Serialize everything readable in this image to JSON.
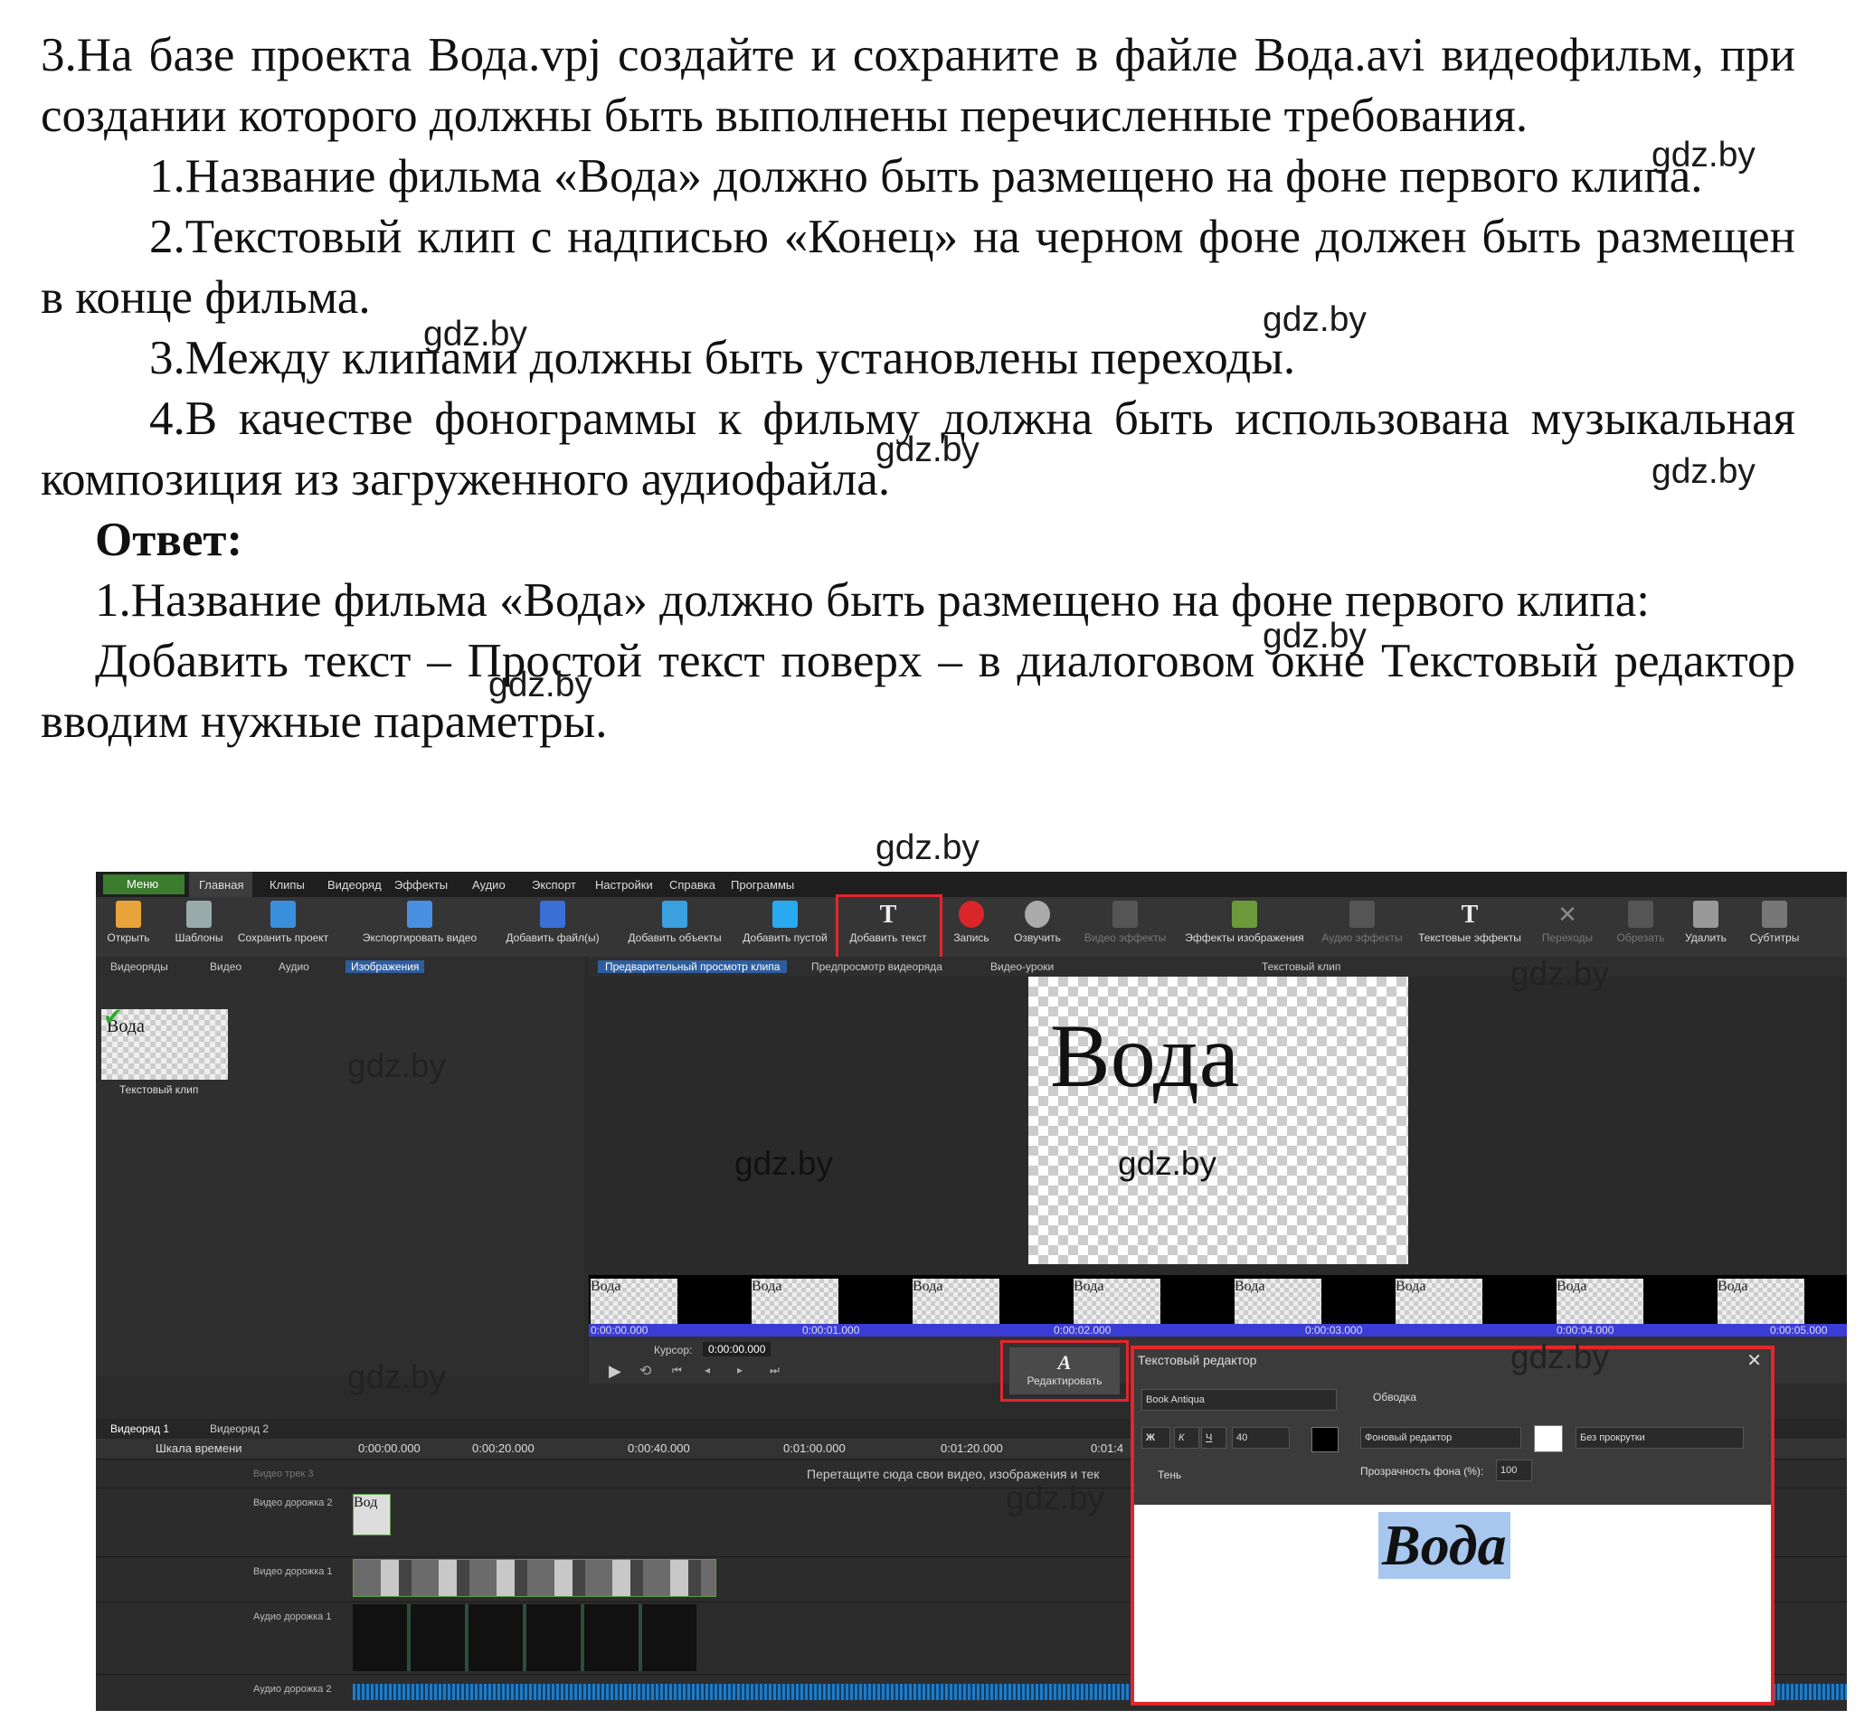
{
  "task": {
    "intro": "3.На базе проекта Вода.vpj создайте и сохраните в файле Вода.avi видеофильм, при создании которого должны быть выполнены перечисленные требования.",
    "req1": "1.Название фильма «Вода» должно быть размещено на фоне первого клипа.",
    "req2": "2.Текстовый клип с надписью «Конец» на черном фоне должен быть размещен в конце фильма.",
    "req3": "3.Между клипами должны быть установлены переходы.",
    "req4": "4.В качестве фонограммы к фильму должна быть использована музыкальная композиция из загруженного аудиофайла."
  },
  "answer": {
    "heading": "Ответ:",
    "line1": "1.Название фильма «Вода» должно быть размещено на фоне первого клипа:",
    "line2": "Добавить текст – Простой текст поверх – в диалоговом окне Текстовый редактор вводим нужные параметры."
  },
  "watermark": "gdz.by",
  "screenshot": {
    "menu": [
      "Меню",
      "Главная",
      "Клипы",
      "Видеоряд",
      "Эффекты",
      "Аудио",
      "Экспорт",
      "Настройки",
      "Справка",
      "Программы"
    ],
    "toolbar": [
      "Открыть",
      "Шаблоны",
      "Сохранить проект",
      "Экспортировать видео",
      "Добавить файл(ы)",
      "Добавить объекты",
      "Добавить пустой",
      "Добавить текст",
      "Запись",
      "Озвучить",
      "Видео эффекты",
      "Эффекты изображения",
      "Аудио эффекты",
      "Текстовые эффекты",
      "Переходы",
      "Обрезать",
      "Удалить",
      "Субтитры"
    ],
    "left_tabs": [
      "Видеоряды",
      "Видео",
      "Аудио",
      "Изображения"
    ],
    "preview_tabs": [
      "Предварительный просмотр клипа",
      "Предпросмотр видеоряда",
      "Видео-уроки"
    ],
    "preview_title": "Текстовый клип",
    "clip_thumb_text": "Вода",
    "clip_thumb_label": "Текстовый клип",
    "canvas_text": "Вода",
    "strip_label": "Вода",
    "ruler": [
      "0:00:00.000",
      "0:00:01.000",
      "0:00:02.000",
      "0:00:03.000",
      "0:00:04.000",
      "0:00:05.000"
    ],
    "cursor_label": "Курсор:",
    "cursor_value": "0:00:00.000",
    "edit_button": "Редактировать",
    "timeline_tabs": [
      "Видеоряд 1",
      "Видеоряд 2"
    ],
    "timeline_scale": "Шкала времени",
    "timeline_ruler": [
      "0:00:00.000",
      "0:00:20.000",
      "0:00:40.000",
      "0:01:00.000",
      "0:01:20.000",
      "0:01:4"
    ],
    "tracks": [
      "Видео трек 3",
      "Видео дорожка 2",
      "Видео дорожка 1",
      "Аудио дорожка 1",
      "Аудио дорожка 2"
    ],
    "drop_hint": "Перетащите сюда свои видео, изображения и тек",
    "text_clip_label": "Вод",
    "editor": {
      "title": "Текстовый редактор",
      "font": "Book Antiqua",
      "bold": "Ж",
      "italic": "К",
      "underline": "Ч",
      "size": "40",
      "shadow": "Тень",
      "outline": "Обводка",
      "bg_mode": "Фоновый редактор",
      "bg_opacity_label": "Прозрачность фона (%):",
      "bg_opacity": "100",
      "scroll": "Без прокрутки",
      "text": "Вода"
    }
  }
}
